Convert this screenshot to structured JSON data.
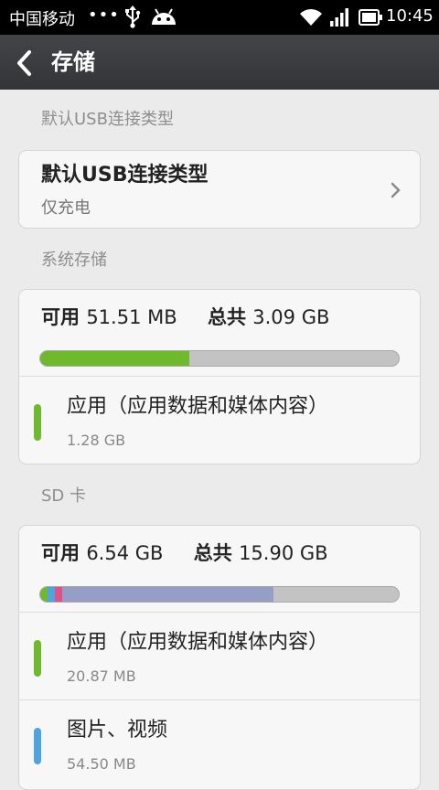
{
  "status_bar": {
    "carrier": "中国移动",
    "dots": "•••",
    "time": "10:45",
    "icons": [
      "usb-icon",
      "android-icon",
      "wifi-icon",
      "signal-icon",
      "battery-icon"
    ]
  },
  "header": {
    "title": "存储",
    "back_icon": "chevron-left-icon"
  },
  "usb_section": {
    "label": "默认USB连接类型",
    "title": "默认USB连接类型",
    "value": "仅充电"
  },
  "system_storage": {
    "label": "系统存储",
    "available_label": "可用",
    "available_value": "51.51 MB",
    "total_label": "总共",
    "total_value": "3.09 GB",
    "bar": {
      "segments": [
        {
          "name": "应用（应用数据和媒体内容）",
          "fraction": 0.415,
          "color": "#6fba2c"
        }
      ],
      "track_color": "#c3c3c3"
    },
    "items": [
      {
        "title": "应用（应用数据和媒体内容）",
        "size": "1.28 GB",
        "color": "#6fba2c"
      }
    ]
  },
  "sd_card": {
    "label": "SD 卡",
    "available_label": "可用",
    "available_value": "6.54 GB",
    "total_label": "总共",
    "total_value": "15.90 GB",
    "bar": {
      "segments": [
        {
          "name": "应用（应用数据和媒体内容）",
          "fraction": 0.02,
          "color": "#6fba2c"
        },
        {
          "name": "图片、视频",
          "fraction": 0.02,
          "color": "#4fa3e0"
        },
        {
          "name": "pink",
          "fraction": 0.02,
          "color": "#e0508a"
        },
        {
          "name": "blue-gray",
          "fraction": 0.59,
          "color": "#959ec6"
        }
      ],
      "track_color": "#c3c3c3"
    },
    "items": [
      {
        "title": "应用（应用数据和媒体内容）",
        "size": "20.87 MB",
        "color": "#6fba2c"
      },
      {
        "title": "图片、视频",
        "size": "54.50 MB",
        "color": "#4fa3e0"
      }
    ]
  }
}
